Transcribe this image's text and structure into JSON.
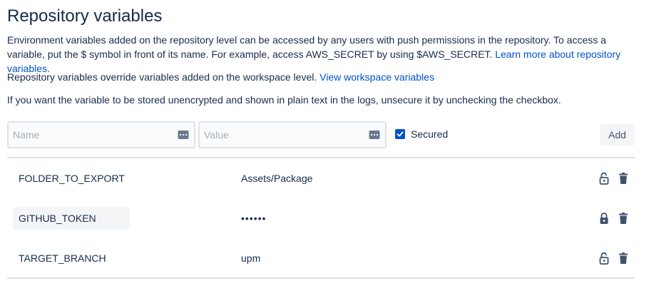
{
  "page": {
    "title": "Repository variables",
    "intro_text": "Environment variables added on the repository level can be accessed by any users with push permissions in the repository. To access a variable, put the $ symbol in front of its name. For example, access AWS_SECRET by using $AWS_SECRET.",
    "intro_link": "Learn more about repository variables",
    "intro_end": ".",
    "override_text": "Repository variables override variables added on the workspace level.",
    "override_link": "View workspace variables",
    "unsecure_text": "If you want the variable to be stored unencrypted and shown in plain text in the logs, unsecure it by unchecking the checkbox."
  },
  "form": {
    "name_placeholder": "Name",
    "name_value": "",
    "value_placeholder": "Value",
    "value_value": "",
    "secured_label": "Secured",
    "secured_checked": true,
    "add_label": "Add"
  },
  "variables": [
    {
      "name": "FOLDER_TO_EXPORT",
      "value": "Assets/Package",
      "secured": false,
      "lock_icon": "unlocked-icon"
    },
    {
      "name": "GITHUB_TOKEN",
      "value": "••••••",
      "secured": true,
      "lock_icon": "locked-icon"
    },
    {
      "name": "TARGET_BRANCH",
      "value": "upm",
      "secured": false,
      "lock_icon": "unlocked-icon"
    }
  ],
  "colors": {
    "text": "#172b4d",
    "link": "#0052cc",
    "checkbox": "#0052cc",
    "icon": "#42526e",
    "border": "#dfe1e6"
  }
}
